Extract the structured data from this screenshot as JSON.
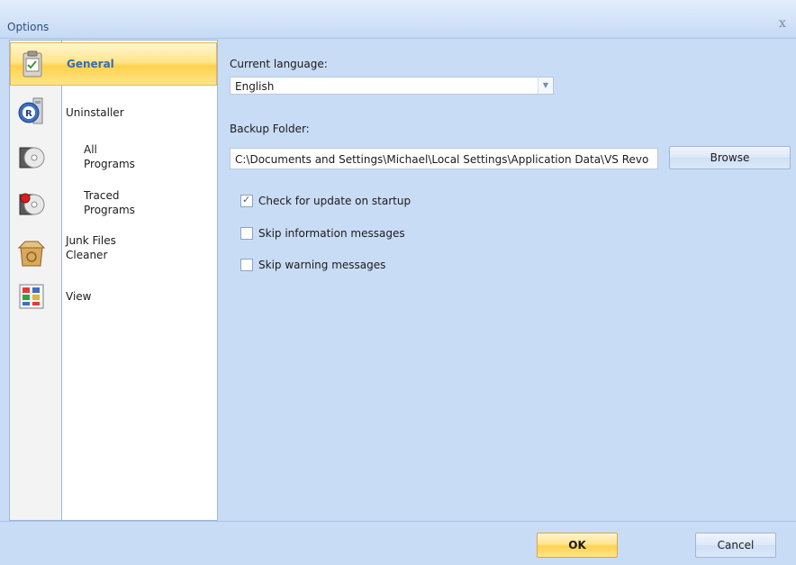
{
  "window": {
    "title": "Options",
    "close_glyph": "x"
  },
  "sidebar": {
    "items": [
      {
        "label": "General",
        "icon": "clipboard-check-icon",
        "selected": true
      },
      {
        "label": "Uninstaller",
        "icon": "uninstaller-icon"
      },
      {
        "label_line1": "All",
        "label_line2": "Programs",
        "icon": "cd-box-icon"
      },
      {
        "label_line1": "Traced",
        "label_line2": "Programs",
        "icon": "traced-cd-icon"
      },
      {
        "label_line1": "Junk Files",
        "label_line2": "Cleaner",
        "icon": "recycle-box-icon"
      },
      {
        "label": "View",
        "icon": "view-grid-icon"
      }
    ]
  },
  "general": {
    "language_label": "Current language:",
    "language_value": "English",
    "backup_label": "Backup Folder:",
    "backup_value": "C:\\Documents and Settings\\Michael\\Local Settings\\Application Data\\VS Revo",
    "browse_label": "Browse",
    "options": [
      {
        "label": "Check for update on startup",
        "checked": true
      },
      {
        "label": "Skip information messages",
        "checked": false
      },
      {
        "label": "Skip warning messages",
        "checked": false
      }
    ]
  },
  "footer": {
    "ok_label": "OK",
    "cancel_label": "Cancel"
  },
  "colors": {
    "accent": "#3a6bb3",
    "selection": "#ffd24d",
    "frame": "#c9dcf5"
  }
}
